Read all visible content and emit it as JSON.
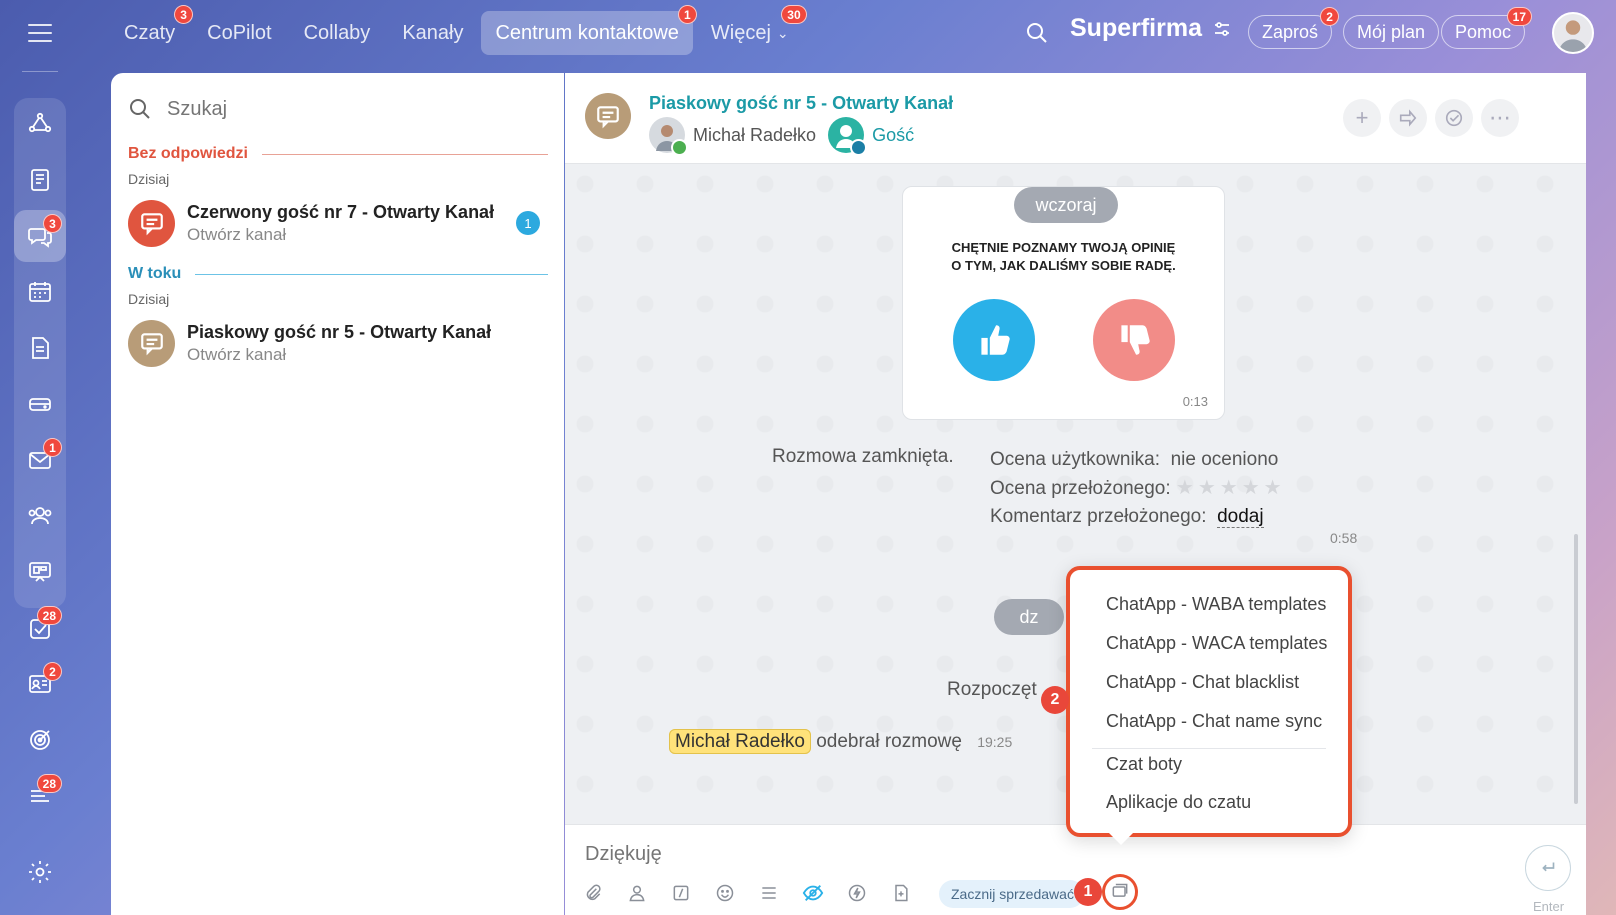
{
  "topbar": {
    "tabs": [
      {
        "label": "Czaty",
        "badge": "3"
      },
      {
        "label": "CoPilot",
        "badge": ""
      },
      {
        "label": "Collaby",
        "badge": ""
      },
      {
        "label": "Kanały",
        "badge": ""
      },
      {
        "label": "Centrum kontaktowe",
        "badge": "1"
      },
      {
        "label": "Więcej",
        "badge": "30"
      }
    ],
    "brand": "Superfirma",
    "invite_label": "Zaproś",
    "invite_badge": "2",
    "plan_label": "Mój plan",
    "help_label": "Pomoc",
    "help_badge": "17"
  },
  "rail": {
    "chat_badge": "3",
    "mail_badge": "1",
    "tasks_badge": "28",
    "crm_badge": "2",
    "feed_badge": "28"
  },
  "left_panel": {
    "search_placeholder": "Szukaj",
    "sections": [
      {
        "title": "Bez odpowiedzi",
        "date": "Dzisiaj",
        "items": [
          {
            "title": "Czerwony gość nr 7 - Otwarty Kanał",
            "subtitle": "Otwórz kanał",
            "count": "1"
          }
        ]
      },
      {
        "title": "W toku",
        "date": "Dzisiaj",
        "items": [
          {
            "title": "Piaskowy gość nr 5 - Otwarty Kanał",
            "subtitle": "Otwórz kanał",
            "count": ""
          }
        ]
      }
    ]
  },
  "chat": {
    "title": "Piaskowy gość nr 5 - Otwarty Kanał",
    "participant_1": "Michał Radełko",
    "participant_2": "Gość",
    "day_yesterday": "wczoraj",
    "survey_line_1": "CHĘTNIE POZNAMY TWOJĄ OPINIĘ",
    "survey_line_2": "O TYM, JAK DALIŚMY SOBIE RADĘ.",
    "survey_time": "0:13",
    "closed_text": "Rozmowa zamknięta.",
    "user_rating_label": "Ocena użytkownika:",
    "user_rating_value": "nie oceniono",
    "supervisor_rating_label": "Ocena przełożonego:",
    "supervisor_comment_label": "Komentarz przełożonego:",
    "supervisor_comment_link": "dodaj",
    "closed_time": "0:58",
    "day_today_partial": "dz",
    "started_partial": "Rozpoczęt",
    "accepted_name": "Michał Radełko",
    "accepted_text": "odebrał rozmowę",
    "accepted_time": "19:25"
  },
  "composer": {
    "placeholder": "Dziękuję",
    "sell_chip": "Zacznij sprzedawać",
    "enter_label": "Enter"
  },
  "popup": {
    "items": [
      "ChatApp - WABA templates",
      "ChatApp - WACA templates",
      "ChatApp - Chat blacklist",
      "ChatApp - Chat name sync",
      "Czat boty",
      "Aplikacje do czatu"
    ]
  },
  "steps": {
    "step_1": "1",
    "step_2": "2"
  },
  "colors": {
    "accent_red": "#e9502f",
    "teal_title": "#1b9aa6",
    "section_red": "#e0553f",
    "section_blue": "#2ca9df",
    "thumb_up": "#2ab1e8",
    "thumb_down": "#f28c88",
    "sand_avatar": "#b89c78"
  }
}
